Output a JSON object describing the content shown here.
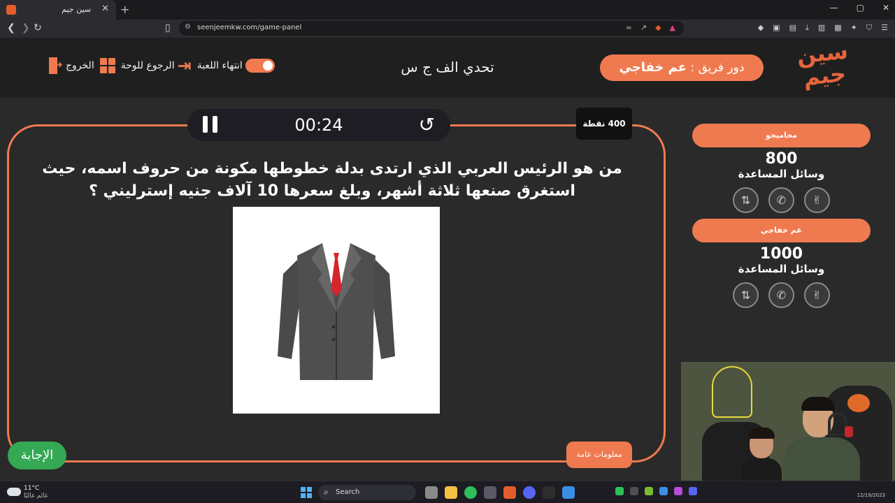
{
  "browser": {
    "tab_title": "سين جيم",
    "tab_close": "✕",
    "new_tab": "+",
    "url": "seenjeemkw.com/game-panel",
    "window_controls": [
      "—",
      "▢",
      "✕"
    ]
  },
  "header": {
    "logo_text": "سين جيم",
    "turn_label": "دور فريق :",
    "turn_team": "عم خفاجي",
    "game_title": "تحدي الف ج س",
    "end_game_label": "انتهاء اللعبة",
    "back_to_board_label": "الرجوع للوحة",
    "exit_label": "الخروج"
  },
  "question_panel": {
    "timer": "00:24",
    "points": "400 نقطة",
    "question": "من هو الرئيس العربي الذي ارتدى بدلة خطوطها مكونة من حروف اسمه، حيث استغرق صنعها ثلاثة أشهر، وبلغ سعرها 10 آلاف جنيه إسترليني ؟",
    "category": "معلومات عامة",
    "answer_button": "الإجابة",
    "image_icon": "suit-image"
  },
  "teams": [
    {
      "name": "محاميجو",
      "score": "800",
      "aids_label": "وسائل المساعدة"
    },
    {
      "name": "عم خفاجي",
      "score": "1000",
      "aids_label": "وسائل المساعدة"
    }
  ],
  "taskbar": {
    "weather_temp": "11°C",
    "weather_desc": "غائم غالبًا",
    "search_label": "Search",
    "date": "12/19/2023"
  },
  "colors": {
    "accent": "#f07a50",
    "answer_green": "#34a853",
    "background": "#2a2a2a"
  }
}
